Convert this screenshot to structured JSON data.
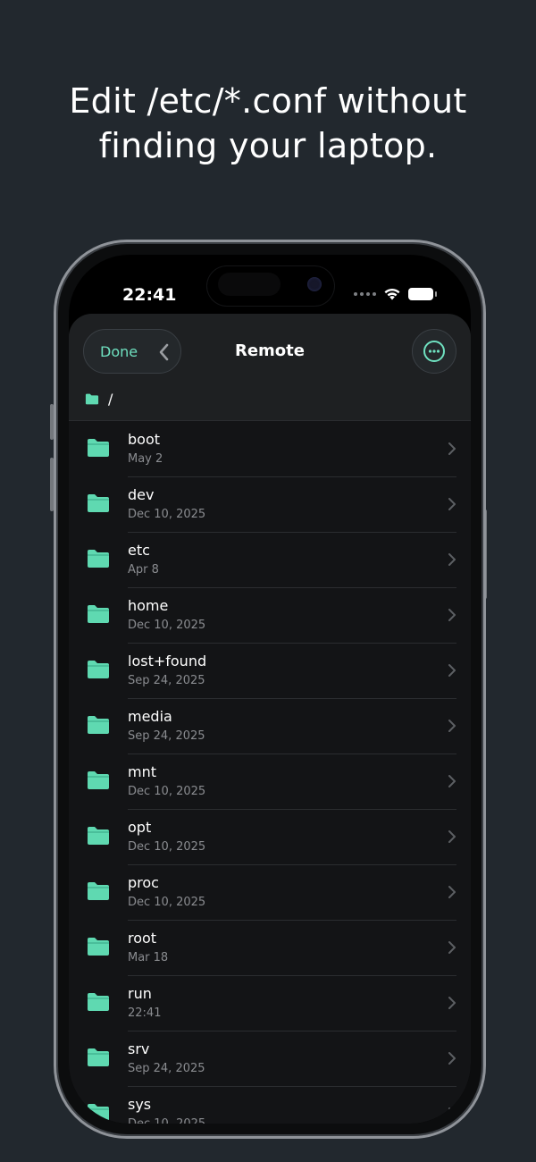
{
  "headline": {
    "line1": "Edit /etc/*.conf without",
    "line2": "finding your laptop."
  },
  "status_bar": {
    "time": "22:41",
    "icons": [
      "signal-dots-icon",
      "wifi-icon",
      "battery-icon"
    ]
  },
  "nav": {
    "done_label": "Done",
    "back_icon": "chevron-left-icon",
    "title": "Remote",
    "more_icon": "ellipsis-circle-icon"
  },
  "path": {
    "icon": "folder-icon",
    "label": "/"
  },
  "files": [
    {
      "name": "boot",
      "date": "May 2"
    },
    {
      "name": "dev",
      "date": "Dec 10, 2025"
    },
    {
      "name": "etc",
      "date": "Apr 8"
    },
    {
      "name": "home",
      "date": "Dec 10, 2025"
    },
    {
      "name": "lost+found",
      "date": "Sep 24, 2025"
    },
    {
      "name": "media",
      "date": "Sep 24, 2025"
    },
    {
      "name": "mnt",
      "date": "Dec 10, 2025"
    },
    {
      "name": "opt",
      "date": "Dec 10, 2025"
    },
    {
      "name": "proc",
      "date": "Dec 10, 2025"
    },
    {
      "name": "root",
      "date": "Mar 18"
    },
    {
      "name": "run",
      "date": "22:41"
    },
    {
      "name": "srv",
      "date": "Sep 24, 2025"
    },
    {
      "name": "sys",
      "date": "Dec 10, 2025"
    }
  ],
  "colors": {
    "accent": "#6fe1c0",
    "background": "#22282e",
    "folder": "#5fd9b1"
  }
}
